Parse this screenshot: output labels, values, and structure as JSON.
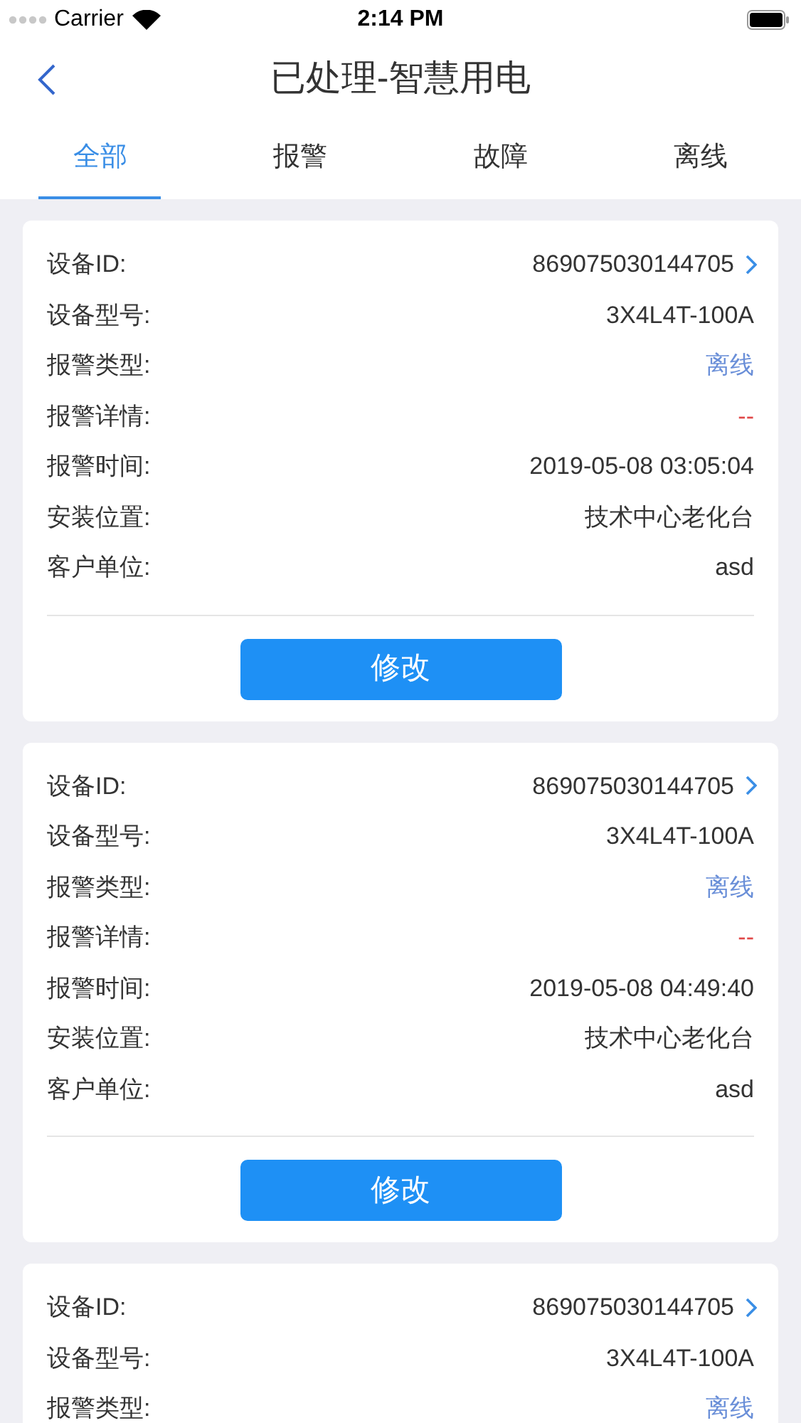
{
  "status_bar": {
    "carrier": "Carrier",
    "time": "2:14 PM"
  },
  "nav": {
    "title": "已处理-智慧用电"
  },
  "tabs": [
    {
      "label": "全部",
      "selected": true
    },
    {
      "label": "报警",
      "selected": false
    },
    {
      "label": "故障",
      "selected": false
    },
    {
      "label": "离线",
      "selected": false
    }
  ],
  "cards": [
    {
      "rows": [
        {
          "kind": "link",
          "label": "设备ID:",
          "value": "869075030144705"
        },
        {
          "kind": "plain",
          "label": "设备型号:",
          "value": "3X4L4T-100A"
        },
        {
          "kind": "type",
          "label": "报警类型:",
          "value": "离线"
        },
        {
          "kind": "detail",
          "label": "报警详情:",
          "value": "--"
        },
        {
          "kind": "plain",
          "label": "报警时间:",
          "value": "2019-05-08 03:05:04"
        },
        {
          "kind": "plain",
          "label": "安装位置:",
          "value": "技术中心老化台"
        },
        {
          "kind": "plain",
          "label": "客户单位:",
          "value": "asd"
        }
      ],
      "button": "修改"
    },
    {
      "rows": [
        {
          "kind": "link",
          "label": "设备ID:",
          "value": "869075030144705"
        },
        {
          "kind": "plain",
          "label": "设备型号:",
          "value": "3X4L4T-100A"
        },
        {
          "kind": "type",
          "label": "报警类型:",
          "value": "离线"
        },
        {
          "kind": "detail",
          "label": "报警详情:",
          "value": "--"
        },
        {
          "kind": "plain",
          "label": "报警时间:",
          "value": "2019-05-08 04:49:40"
        },
        {
          "kind": "plain",
          "label": "安装位置:",
          "value": "技术中心老化台"
        },
        {
          "kind": "plain",
          "label": "客户单位:",
          "value": "asd"
        }
      ],
      "button": "修改"
    },
    {
      "rows": [
        {
          "kind": "link",
          "label": "设备ID:",
          "value": "869075030144705"
        },
        {
          "kind": "plain",
          "label": "设备型号:",
          "value": "3X4L4T-100A"
        },
        {
          "kind": "type",
          "label": "报警类型:",
          "value": "离线"
        }
      ]
    }
  ]
}
